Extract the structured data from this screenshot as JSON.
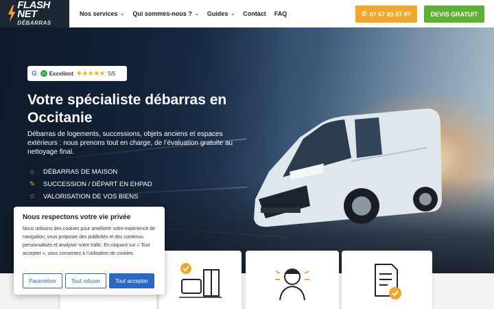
{
  "header": {
    "logo_main": "FLASH NET",
    "logo_sub": "DÉBARRAS",
    "nav": [
      {
        "label": "Nos services",
        "has_dropdown": true
      },
      {
        "label": "Qui sommes-nous ?",
        "has_dropdown": true
      },
      {
        "label": "Guides",
        "has_dropdown": true
      },
      {
        "label": "Contact",
        "has_dropdown": false
      },
      {
        "label": "FAQ",
        "has_dropdown": false
      }
    ],
    "phone": "07 67 83 57 87",
    "quote": "DEVIS GRATUIT"
  },
  "hero": {
    "rating": {
      "provider": "G",
      "label": "Excellent",
      "stars": "★★★★★",
      "score": "5/5"
    },
    "title": "Votre spécialiste débarras en Occitanie",
    "subtitle": "Débarras de logements, successions, objets anciens et espaces extérieurs : nous prenons tout en charge, de l’évaluation gratuite au nettoyage final.",
    "features": [
      {
        "icon": "home-icon",
        "label": "DÉBARRAS DE MAISON"
      },
      {
        "icon": "quill-icon",
        "label": "SUCCESSION / DÉPART EN EHPAD"
      },
      {
        "icon": "star-icon",
        "label": "VALORISATION DE VOS BIENS"
      }
    ]
  },
  "cards": [
    {
      "icon": "house-icon"
    },
    {
      "icon": "furniture-icon"
    },
    {
      "icon": "worker-icon"
    },
    {
      "icon": "document-check-icon"
    }
  ],
  "cookie": {
    "title": "Nous respectons votre vie privée",
    "text": "Nous utilisons des cookies pour améliorer votre expérience de navigation, vous proposer des publicités et des contenus personnalisés et analyser notre trafic. En cliquant sur « Tout accepter », vous consentez à l’utilisation de cookies.",
    "btn_settings": "Paramétrer",
    "btn_refuse": "Tout refuser",
    "btn_accept": "Tout accepter"
  },
  "colors": {
    "accent_orange": "#f4a62a",
    "accent_green": "#5fb032",
    "cookie_blue": "#2a67c7",
    "logo_bg": "#1d2733"
  }
}
